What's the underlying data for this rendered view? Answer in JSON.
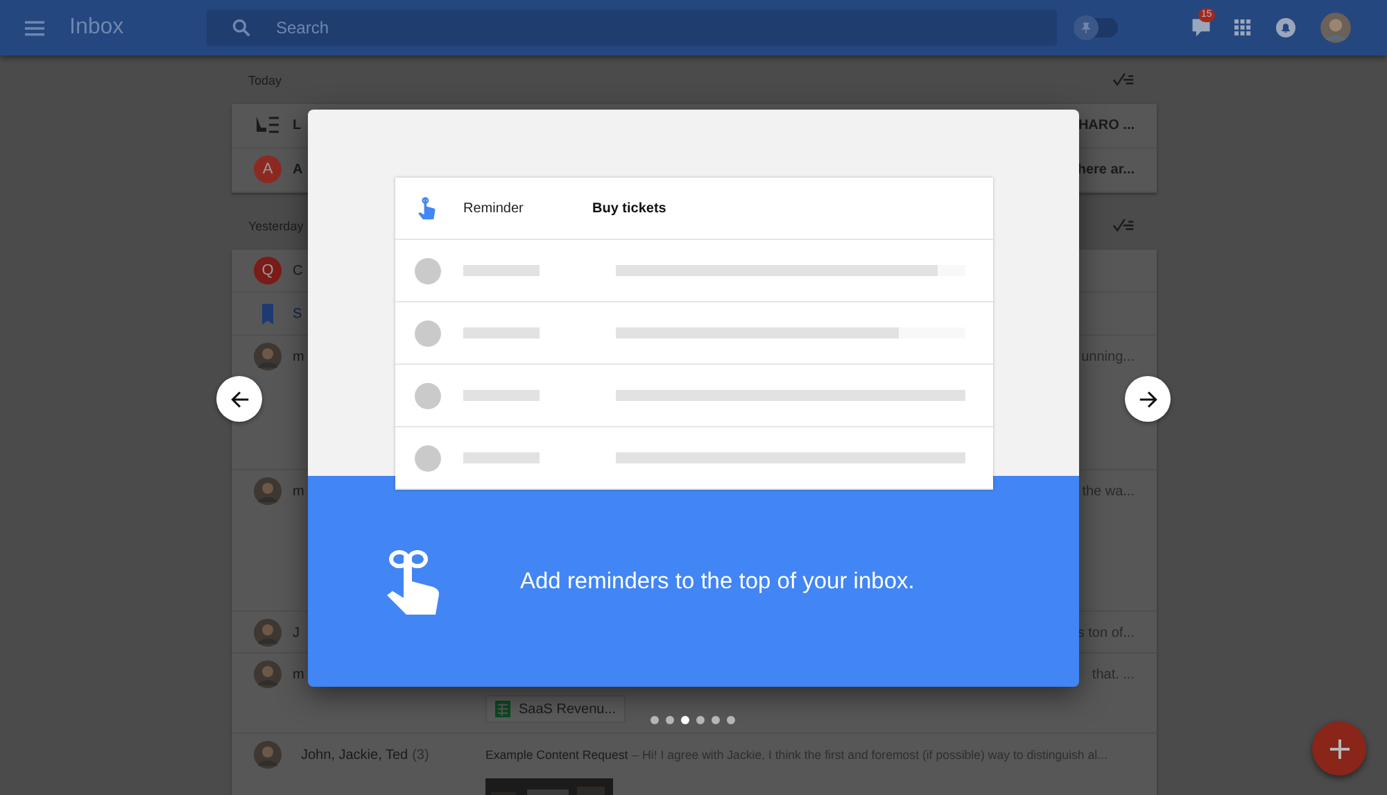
{
  "app_bar": {
    "title": "Inbox",
    "search": {
      "placeholder": "Search"
    },
    "pin_toggle": {
      "on": false
    },
    "notification_count": "15"
  },
  "sections": [
    {
      "heading": "Today",
      "rows": [
        {
          "kind": "bundle",
          "sender": "L",
          "bold": true,
          "preview": "HARO ..."
        },
        {
          "kind": "letter",
          "avatar_letter": "A",
          "color": "#8c2a22",
          "sender": "A",
          "bold": true,
          "preview": "here ar..."
        }
      ]
    },
    {
      "heading": "Yesterday",
      "rows": [
        {
          "kind": "letter",
          "avatar_letter": "Q",
          "color": "#7a1c17",
          "sender": "C",
          "bold": false
        },
        {
          "kind": "bookmark",
          "sender": "S",
          "bold": false
        },
        {
          "kind": "person",
          "sender": "m",
          "bold": false,
          "preview": "unning..."
        },
        {
          "kind": "person",
          "sender": "m",
          "bold": false,
          "preview": "the wa..."
        },
        {
          "kind": "person",
          "sender": "J",
          "bold": false,
          "preview": "s ton of..."
        },
        {
          "kind": "person",
          "sender": "m",
          "bold": false,
          "preview": "that. ...",
          "attachment": "SaaS Revenu..."
        },
        {
          "kind": "person",
          "sender": "John, Jackie, Ted",
          "count": "(3)",
          "subject": "Example Content Request",
          "bold": false,
          "preview": "– Hi! I agree with Jackie, I think the first and foremost (if possible) way to distinguish al...",
          "image": true
        }
      ]
    }
  ],
  "tutorial": {
    "sample_item": {
      "label": "Reminder",
      "title": "Buy tickets"
    },
    "placeholder_rows": [
      {
        "level": 0.92
      },
      {
        "level": 0.81
      },
      {
        "level": 1
      },
      {
        "level": 1
      }
    ],
    "message": "Add reminders to the top of your inbox."
  },
  "pager": [
    {
      "selected": false
    },
    {
      "selected": false
    },
    {
      "selected": true
    },
    {
      "selected": false
    },
    {
      "selected": false
    },
    {
      "selected": false
    }
  ]
}
